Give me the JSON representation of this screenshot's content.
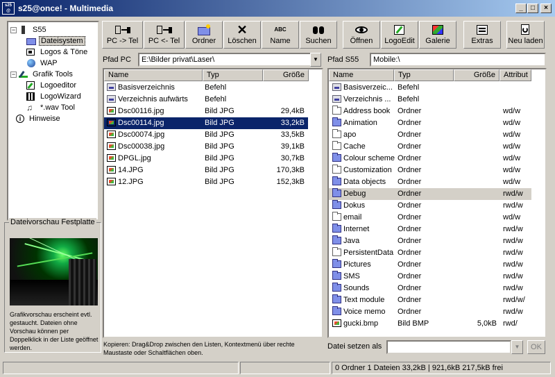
{
  "window": {
    "title": "s25@once! - Multimedia",
    "logo_text": "s25 at once"
  },
  "tree": {
    "items": [
      {
        "label": "S55",
        "icon": "phone-icon"
      },
      {
        "label": "Dateisystem",
        "icon": "folder-icon"
      },
      {
        "label": "Logos & Töne",
        "icon": "logos-icon"
      },
      {
        "label": "WAP",
        "icon": "globe-icon"
      },
      {
        "label": "Grafik Tools",
        "icon": "graphic-tools-icon"
      },
      {
        "label": "Logoeditor",
        "icon": "logoeditor-icon"
      },
      {
        "label": "LogoWizard",
        "icon": "logowizard-icon"
      },
      {
        "label": "*.wav Tool",
        "icon": "music-note-icon"
      },
      {
        "label": "Hinweise",
        "icon": "info-icon"
      }
    ]
  },
  "preview": {
    "title": "Dateivorschau Festplatte",
    "note": "Grafikvorschau erscheint evtl. gestaucht. Dateien ohne Vorschau können per Doppelklick in der Liste geöffnet werden."
  },
  "toolbar": {
    "pc_to_tel": "PC -> Tel",
    "tel_to_pc": "PC <- Tel",
    "ordner": "Ordner",
    "loeschen": "Löschen",
    "name": "Name",
    "suchen": "Suchen",
    "oeffnen": "Öffnen",
    "logoedit": "LogoEdit",
    "galerie": "Galerie",
    "extras": "Extras",
    "neu_laden": "Neu laden",
    "abc": "ABC"
  },
  "pc": {
    "path_label": "Pfad PC",
    "path_value": "E:\\Bilder privat\\Laser\\",
    "headers": {
      "name": "Name",
      "typ": "Typ",
      "groesse": "Größe"
    },
    "rows": [
      {
        "name": "Basisverzeichnis",
        "typ": "Befehl",
        "size": "",
        "icon": "command"
      },
      {
        "name": "Verzeichnis aufwärts",
        "typ": "Befehl",
        "size": "",
        "icon": "command"
      },
      {
        "name": "Dsc00116.jpg",
        "typ": "Bild JPG",
        "size": "29,4kB",
        "icon": "jpg"
      },
      {
        "name": "Dsc00114.jpg",
        "typ": "Bild JPG",
        "size": "33,2kB",
        "icon": "jpg"
      },
      {
        "name": "Dsc00074.jpg",
        "typ": "Bild JPG",
        "size": "33,5kB",
        "icon": "jpg"
      },
      {
        "name": "Dsc00038.jpg",
        "typ": "Bild JPG",
        "size": "39,1kB",
        "icon": "jpg"
      },
      {
        "name": "DPGL.jpg",
        "typ": "Bild JPG",
        "size": "30,7kB",
        "icon": "jpg"
      },
      {
        "name": "14.JPG",
        "typ": "Bild JPG",
        "size": "170,3kB",
        "icon": "jpg"
      },
      {
        "name": "12.JPG",
        "typ": "Bild JPG",
        "size": "152,3kB",
        "icon": "jpg"
      }
    ],
    "selected_index": 3
  },
  "s55": {
    "path_label": "Pfad S55",
    "path_value": "Mobile:\\",
    "headers": {
      "name": "Name",
      "typ": "Typ",
      "groesse": "Größe",
      "attribut": "Attribut"
    },
    "rows": [
      {
        "name": "Basisverzeic...",
        "typ": "Befehl",
        "size": "",
        "attr": "",
        "icon": "command"
      },
      {
        "name": "Verzeichnis ...",
        "typ": "Befehl",
        "size": "",
        "attr": "",
        "icon": "command"
      },
      {
        "name": "Address book",
        "typ": "Ordner",
        "size": "",
        "attr": "wd/w",
        "icon": "folder-white"
      },
      {
        "name": "Animation",
        "typ": "Ordner",
        "size": "",
        "attr": "wd/w",
        "icon": "folder-blue"
      },
      {
        "name": "apo",
        "typ": "Ordner",
        "size": "",
        "attr": "wd/w",
        "icon": "folder-white"
      },
      {
        "name": "Cache",
        "typ": "Ordner",
        "size": "",
        "attr": "wd/w",
        "icon": "folder-white"
      },
      {
        "name": "Colour scheme",
        "typ": "Ordner",
        "size": "",
        "attr": "wd/w",
        "icon": "folder-blue"
      },
      {
        "name": "Customization",
        "typ": "Ordner",
        "size": "",
        "attr": "wd/w",
        "icon": "folder-white"
      },
      {
        "name": "Data objects",
        "typ": "Ordner",
        "size": "",
        "attr": "wd/w",
        "icon": "folder-blue"
      },
      {
        "name": "Debug",
        "typ": "Ordner",
        "size": "",
        "attr": "rwd/w",
        "icon": "folder-blue"
      },
      {
        "name": "Dokus",
        "typ": "Ordner",
        "size": "",
        "attr": "rwd/w",
        "icon": "folder-blue"
      },
      {
        "name": "email",
        "typ": "Ordner",
        "size": "",
        "attr": "wd/w",
        "icon": "folder-white"
      },
      {
        "name": "Internet",
        "typ": "Ordner",
        "size": "",
        "attr": "rwd/w",
        "icon": "folder-blue"
      },
      {
        "name": "Java",
        "typ": "Ordner",
        "size": "",
        "attr": "rwd/w",
        "icon": "folder-blue"
      },
      {
        "name": "PersistentData",
        "typ": "Ordner",
        "size": "",
        "attr": "rwd/w",
        "icon": "folder-white"
      },
      {
        "name": "Pictures",
        "typ": "Ordner",
        "size": "",
        "attr": "rwd/w",
        "icon": "folder-blue"
      },
      {
        "name": "SMS",
        "typ": "Ordner",
        "size": "",
        "attr": "rwd/w",
        "icon": "folder-blue"
      },
      {
        "name": "Sounds",
        "typ": "Ordner",
        "size": "",
        "attr": "rwd/w",
        "icon": "folder-blue"
      },
      {
        "name": "Text module",
        "typ": "Ordner",
        "size": "",
        "attr": "rwd/w/",
        "icon": "folder-blue"
      },
      {
        "name": "Voice memo",
        "typ": "Ordner",
        "size": "",
        "attr": "rwd/w",
        "icon": "folder-blue"
      },
      {
        "name": "gucki.bmp",
        "typ": "Bild BMP",
        "size": "5,0kB",
        "attr": "rwd/",
        "icon": "jpg"
      }
    ],
    "highlight_index": 9
  },
  "hint": "Kopieren: Drag&Drop zwischen den Listen, Kontextmenü über rechte Maustaste oder Schaltflächen oben.",
  "datei_setzen": {
    "label": "Datei setzen als",
    "value": "",
    "ok": "OK"
  },
  "status": {
    "left": "",
    "middle": "",
    "right": "0 Ordner 1 Dateien 33,2kB | 921,6kB 217,5kB frei"
  },
  "colors": {
    "selection": "#0a246a",
    "title_start": "#0a246a",
    "title_end": "#a6caf0",
    "face": "#d4d0c8"
  }
}
